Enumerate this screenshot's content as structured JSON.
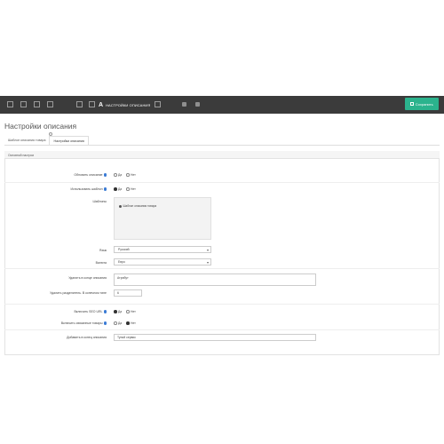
{
  "toolbar": {
    "active_letter": "A",
    "active_title": "НАСТРОЙКИ ОПИСАНИЯ",
    "save_label": "Сохранить",
    "icons": [
      "doc-icon",
      "list-icon",
      "image-icon",
      "chart-icon",
      "grid-icon",
      "edit-icon",
      "arrow-icon",
      "info-icon"
    ]
  },
  "page": {
    "title": "Настройки описания",
    "tabs": [
      {
        "label": "Шаблон описания товара",
        "active": false
      },
      {
        "label": "Настройки описания",
        "active": true
      }
    ]
  },
  "panel": {
    "heading": "Основной настрои",
    "fields": {
      "rewrite_label": "Обновить описание",
      "use_template_label": "Использовать шаблон",
      "templates_label": "Шаблоны",
      "language_label": "Язык",
      "currency_label": "Валюта",
      "attrs_label": "Удалить в конце описания",
      "separator_label": "Удалить разделитель. В конечном типе",
      "seo_label": "Включить SEO URL",
      "related_label": "Включить связанные товары",
      "append_label": "Добавить в конец описания"
    },
    "yes": "Да",
    "no": "Нет",
    "template_item": "Шаблон описания товара",
    "language_value": "Русский",
    "currency_value": "Евро",
    "attrs_value": "Атрибут",
    "separator_value": "6",
    "append_value": "Тупой сервис"
  }
}
